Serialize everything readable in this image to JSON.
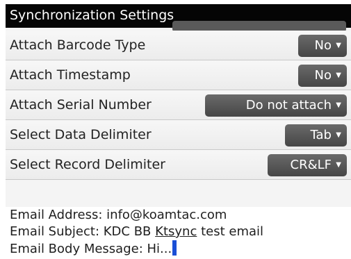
{
  "screen": {
    "title": "Synchronization Settings"
  },
  "settings": [
    {
      "label": "Attach Barcode Type",
      "value": "No"
    },
    {
      "label": "Attach Timestamp",
      "value": "No"
    },
    {
      "label": "Attach Serial Number",
      "value": "Do not attach"
    },
    {
      "label": "Select Data Delimiter",
      "value": "Tab"
    },
    {
      "label": "Select Record Delimiter",
      "value": "CR&LF"
    }
  ],
  "email": {
    "address_label": "Email Address:",
    "address": "info@koamtac.com",
    "subject_label": "Email Subject:",
    "subject_prefix": "KDC BB",
    "subject_word": "Ktsync",
    "subject_suffix": "test email",
    "body_label": "Email Body Message:",
    "body": "Hi..."
  },
  "colors": {
    "titlebar": "#050505",
    "dropdown": "#555555",
    "cursor": "#1a4fd6"
  }
}
